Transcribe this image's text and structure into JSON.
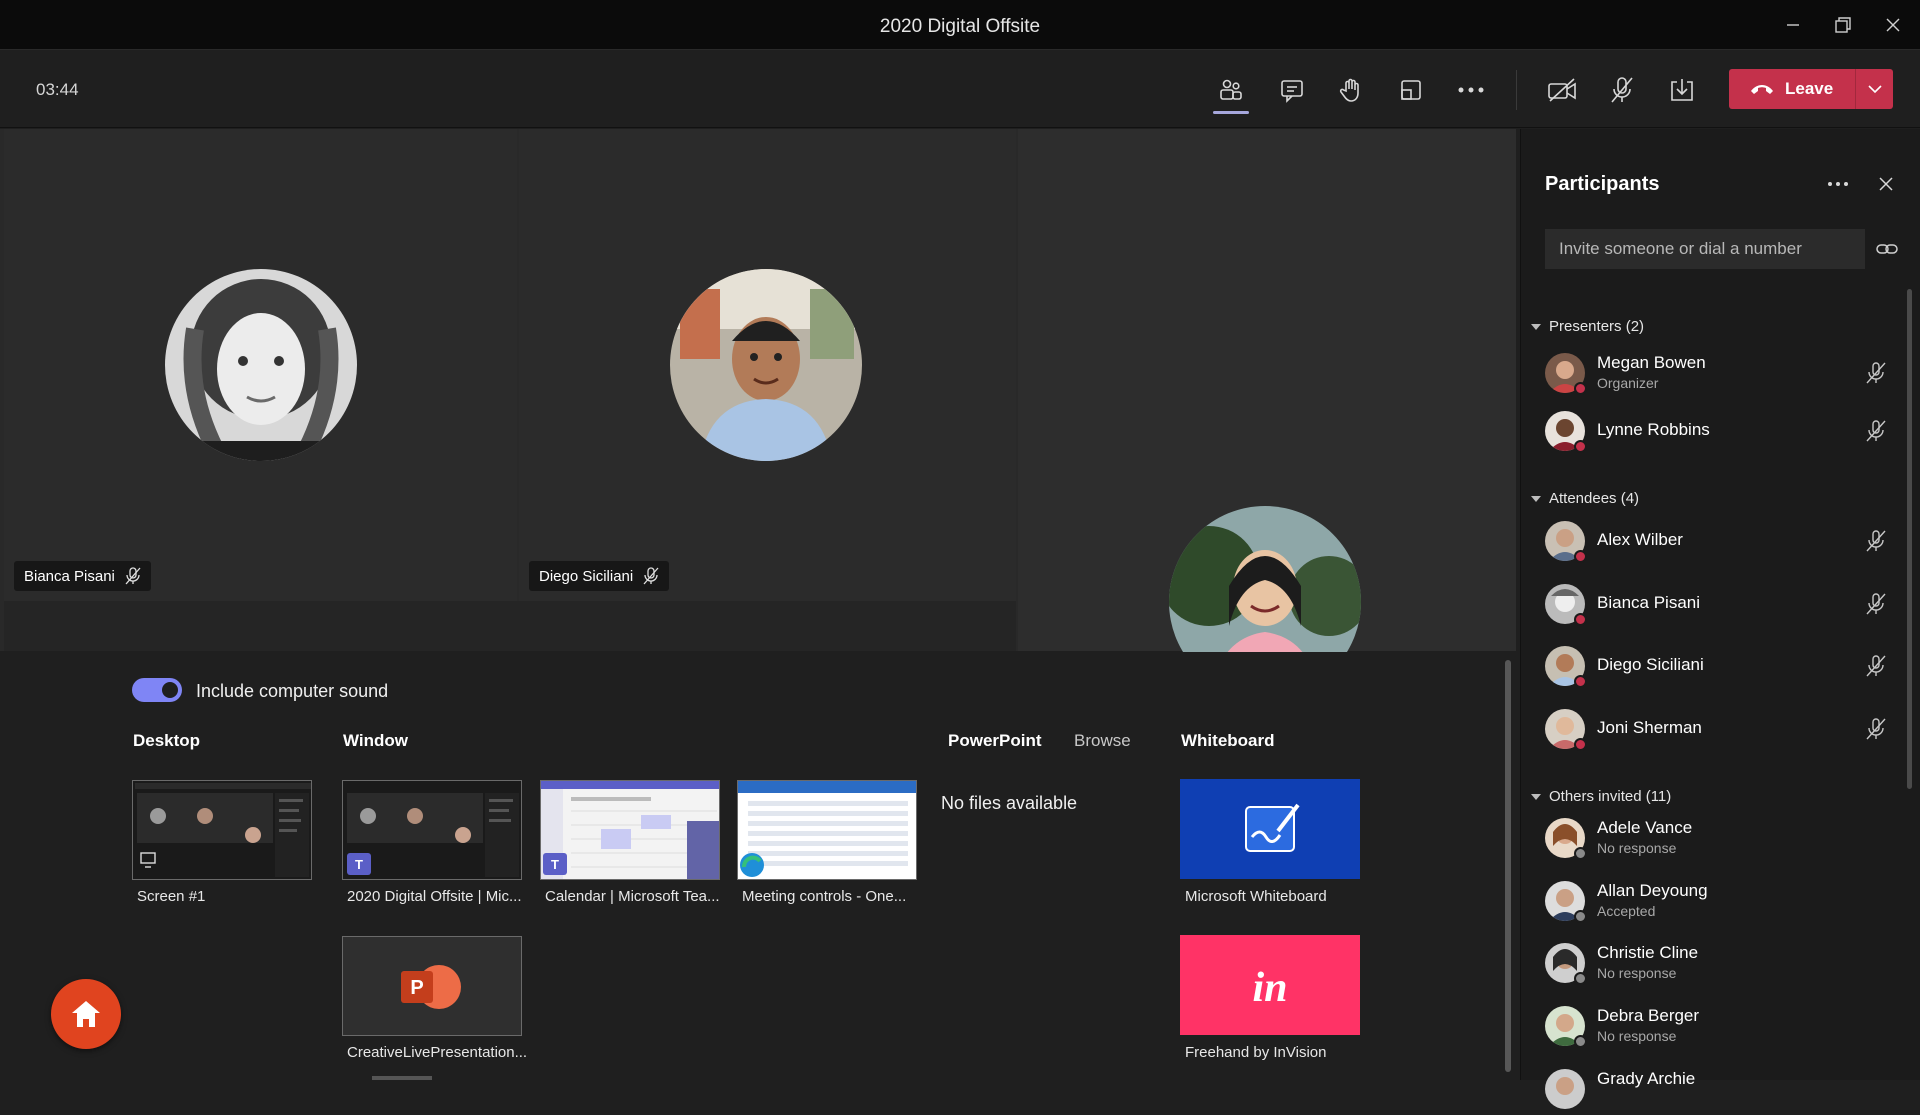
{
  "window": {
    "title": "2020 Digital Offsite"
  },
  "toolbar": {
    "timer": "03:44",
    "leave_label": "Leave"
  },
  "stage": {
    "tiles": [
      {
        "name": "Bianca Pisani"
      },
      {
        "name": "Diego Siciliani"
      }
    ]
  },
  "share": {
    "include_sound_label": "Include computer sound",
    "include_sound_on": true,
    "desktop_heading": "Desktop",
    "window_heading": "Window",
    "powerpoint_heading": "PowerPoint",
    "browse_label": "Browse",
    "whiteboard_heading": "Whiteboard",
    "no_files": "No files available",
    "desktop_items": [
      {
        "label": "Screen #1"
      }
    ],
    "window_items": [
      {
        "label": "2020 Digital Offsite | Mic..."
      },
      {
        "label": "Calendar | Microsoft Tea..."
      },
      {
        "label": "Meeting controls - One..."
      },
      {
        "label": "CreativeLivePresentation..."
      }
    ],
    "whiteboard_items": [
      {
        "label": "Microsoft Whiteboard",
        "color": "#0f3fb3"
      },
      {
        "label": "Freehand by InVision",
        "color": "#ff3366"
      }
    ]
  },
  "participants": {
    "title": "Participants",
    "invite_placeholder": "Invite someone or dial a number",
    "presenters_heading": "Presenters (2)",
    "attendees_heading": "Attendees (4)",
    "others_heading": "Others invited (11)",
    "presenters": [
      {
        "name": "Megan Bowen",
        "role": "Organizer"
      },
      {
        "name": "Lynne Robbins",
        "role": ""
      }
    ],
    "attendees": [
      {
        "name": "Alex Wilber"
      },
      {
        "name": "Bianca Pisani"
      },
      {
        "name": "Diego Siciliani"
      },
      {
        "name": "Joni Sherman"
      }
    ],
    "others": [
      {
        "name": "Adele Vance",
        "status": "No response"
      },
      {
        "name": "Allan Deyoung",
        "status": "Accepted"
      },
      {
        "name": "Christie Cline",
        "status": "No response"
      },
      {
        "name": "Debra Berger",
        "status": "No response"
      },
      {
        "name": "Grady Archie",
        "status": ""
      }
    ]
  },
  "colors": {
    "accent": "#7f85f5",
    "leave": "#c4314b",
    "home": "#e0441f"
  }
}
